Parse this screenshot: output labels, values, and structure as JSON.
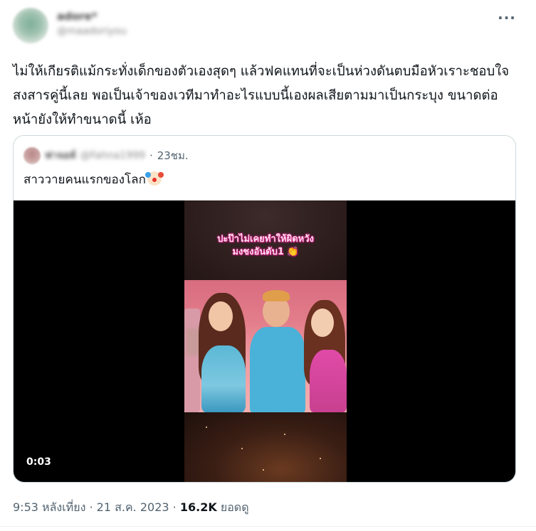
{
  "post": {
    "author_name": "adore*",
    "author_handle": "@maadoriyou",
    "more_label": "···",
    "text": "ไม่ให้เกียรติแม้กระทั่งเด็กของตัวเองสุดๆ แล้วฟคแทนที่จะเป็นห่วงดันตบมือหัวเราะชอบใจ สงสารคู่นี้เลย พอเป็นเจ้าของเวทีมาทำอะไรแบบนี้เองผลเสียตามมาเป็นกระบุง ขนาดต่อหน้ายังให้ทำขนาดนี้ เห้อ"
  },
  "quote": {
    "author_name": "ฟาจอห์",
    "author_handle": "@Fahna1999",
    "separator": "·",
    "time": "23ชม.",
    "text": "สาววายคนแรกของโลก",
    "emoji": "clown-face",
    "video": {
      "caption_line1": "ปะป๊าไม่เคยทำให้ผิดหวัง",
      "caption_line2": "มงชงอันดับ1 👏",
      "duration": "0:03"
    }
  },
  "footer": {
    "time": "9:53 หลังเที่ยง",
    "sep1": "·",
    "date": "21 ส.ค. 2023",
    "sep2": "·",
    "views_count": "16.2K",
    "views_label": "ยอดดู"
  }
}
